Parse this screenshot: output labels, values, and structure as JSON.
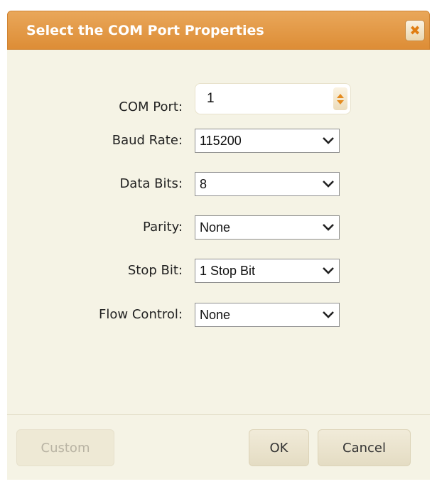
{
  "dialog": {
    "title": "Select the COM Port Properties",
    "close_icon": "close-icon",
    "close_glyph": "✖"
  },
  "form": {
    "com_port": {
      "label": "COM Port:",
      "value": "1"
    },
    "baud_rate": {
      "label": "Baud Rate:",
      "value": "115200"
    },
    "data_bits": {
      "label": "Data Bits:",
      "value": "8"
    },
    "parity": {
      "label": "Parity:",
      "value": "None"
    },
    "stop_bit": {
      "label": "Stop Bit:",
      "value": "1 Stop Bit"
    },
    "flow_control": {
      "label": "Flow Control:",
      "value": "None"
    }
  },
  "buttons": {
    "custom": "Custom",
    "ok": "OK",
    "cancel": "Cancel"
  },
  "colors": {
    "titlebar": "#dd8d36",
    "body_bg": "#f5f3e5",
    "accent_icon": "#e58b1f"
  }
}
